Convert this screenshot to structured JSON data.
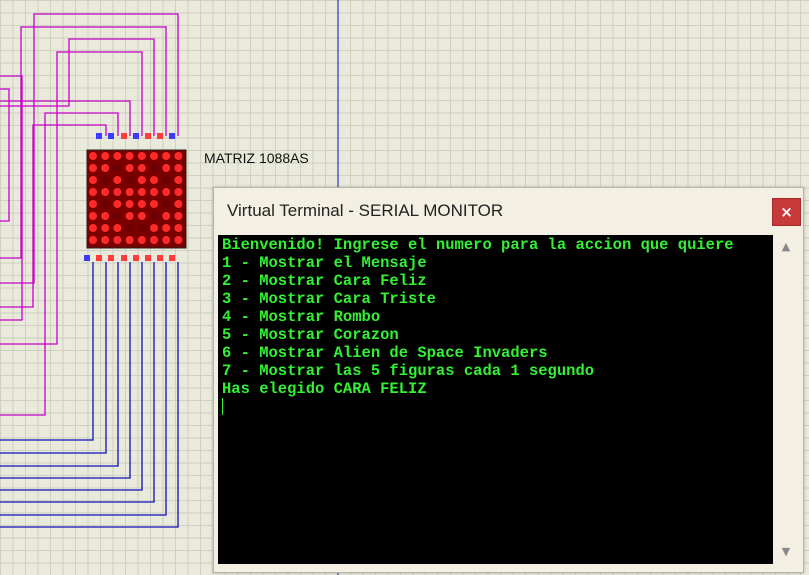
{
  "schematic": {
    "component_label": "MATRIZ 1088AS",
    "colors": {
      "top_wire": "#c800c8",
      "bottom_wire": "#1010b8",
      "divider": "#1010c8",
      "pin_red": "#ff3b3b",
      "pin_blue": "#3b3bff",
      "led_on": "#ff2a2a",
      "led_off": "#6a0000",
      "matrix_body": "#7a0000"
    },
    "icons": [
      "led-matrix-icon"
    ]
  },
  "terminal": {
    "title": "Virtual Terminal - SERIAL MONITOR",
    "close_label": "×",
    "lines": [
      "Bienvenido! Ingrese el numero para la accion que quiere",
      "1 - Mostrar el Mensaje",
      "2 - Mostrar Cara Feliz",
      "3 - Mostrar Cara Triste",
      "4 - Mostrar Rombo",
      "5 - Mostrar Corazon",
      "6 - Mostrar Alien de Space Invaders",
      "7 - Mostrar las 5 figuras cada 1 segundo",
      "Has elegido CARA FELIZ"
    ],
    "text_color": "#33f033",
    "background": "#000000",
    "scroll_up_icon": "▲",
    "scroll_down_icon": "▼"
  }
}
